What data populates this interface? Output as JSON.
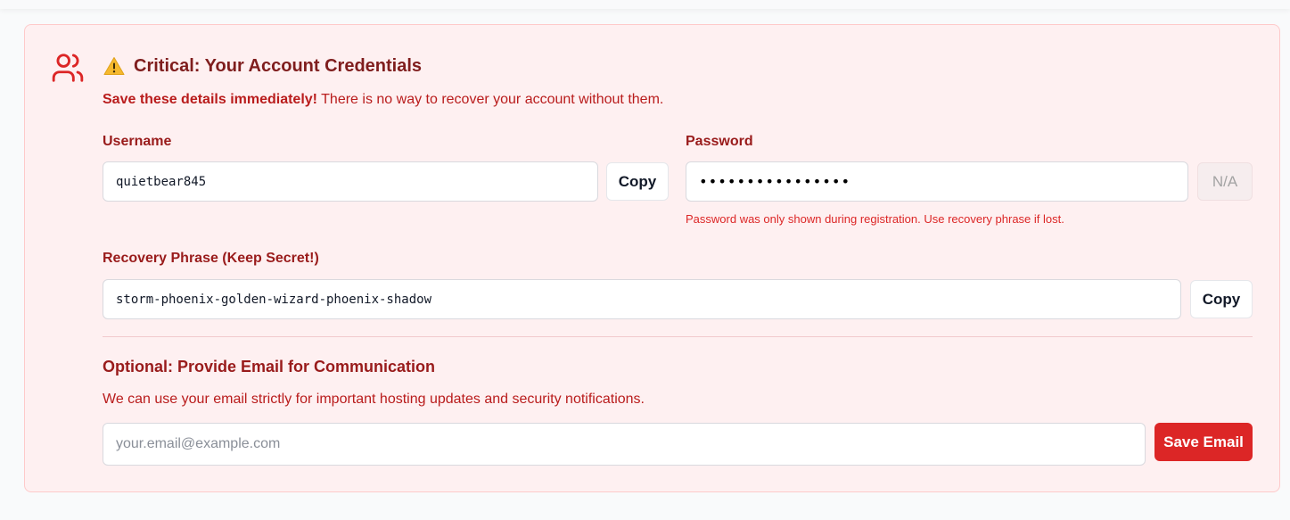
{
  "header": {
    "icon": "users-icon",
    "warning_icon": "warning-icon",
    "title": "Critical: Your Account Credentials",
    "lead_bold": "Save these details immediately!",
    "lead_text": " There is no way to recover your account without them."
  },
  "username": {
    "label": "Username",
    "value": "quietbear845",
    "copy_label": "Copy"
  },
  "password": {
    "label": "Password",
    "value": "••••••••••••••••",
    "button_label": "N/A",
    "hint": "Password was only shown during registration. Use recovery phrase if lost."
  },
  "recovery": {
    "label": "Recovery Phrase (Keep Secret!)",
    "value": "storm-phoenix-golden-wizard-phoenix-shadow",
    "copy_label": "Copy"
  },
  "email_section": {
    "title": "Optional: Provide Email for Communication",
    "description": "We can use your email strictly for important hosting updates and security notifications.",
    "placeholder": "your.email@example.com",
    "value": "",
    "save_label": "Save Email"
  },
  "colors": {
    "accent": "#dc2626",
    "panel_bg": "#fef0f1",
    "panel_border": "#fecaca",
    "text_dark_red": "#7f1d1d"
  }
}
